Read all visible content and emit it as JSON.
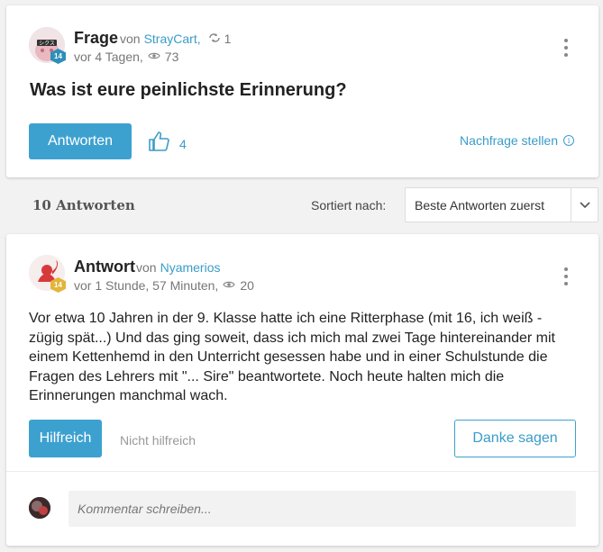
{
  "question": {
    "type_label": "Frage",
    "by_label": "von",
    "author": "StrayCart,",
    "repost_count": "1",
    "time": "vor 4 Tagen,",
    "views": "73",
    "avatar_level": "14",
    "title": "Was ist eure peinlichste Erinnerung?",
    "answer_button": "Antworten",
    "likes": "4",
    "followup_label": "Nachfrage stellen",
    "followup_icon_glyph": "i"
  },
  "sort": {
    "answers_count": "10 Antworten",
    "label": "Sortiert nach:",
    "selected": "Beste Antworten zuerst"
  },
  "answer": {
    "type_label": "Antwort",
    "by_label": "von",
    "author": "Nyamerios",
    "time": "vor 1 Stunde, 57 Minuten,",
    "views": "20",
    "avatar_level": "14",
    "text": "Vor etwa 10 Jahren in der 9. Klasse hatte ich eine Ritterphase (mit 16, ich weiß - zügig spät...) Und das ging soweit, dass ich mich mal zwei Tage hintereinander mit einem Kettenhemd in den Unterricht gesessen habe und in einer Schulstunde die Fragen des Lehrers mit \"... Sire\" beantwortete. Noch heute halten mich die Erinnerungen manchmal wach.",
    "helpful_button": "Hilfreich",
    "not_helpful_button": "Nicht hilfreich",
    "thanks_button": "Danke sagen"
  },
  "comment": {
    "placeholder": "Kommentar schreiben..."
  },
  "colors": {
    "accent": "#3da1d0",
    "background": "#f2f2f2",
    "question_badge": "#2e8fb8",
    "answer_badge": "#e3b53a"
  },
  "icons": [
    "repost-icon",
    "eye-icon",
    "thumbs-up-icon",
    "info-icon",
    "chevron-down-icon",
    "kebab-menu-icon"
  ]
}
